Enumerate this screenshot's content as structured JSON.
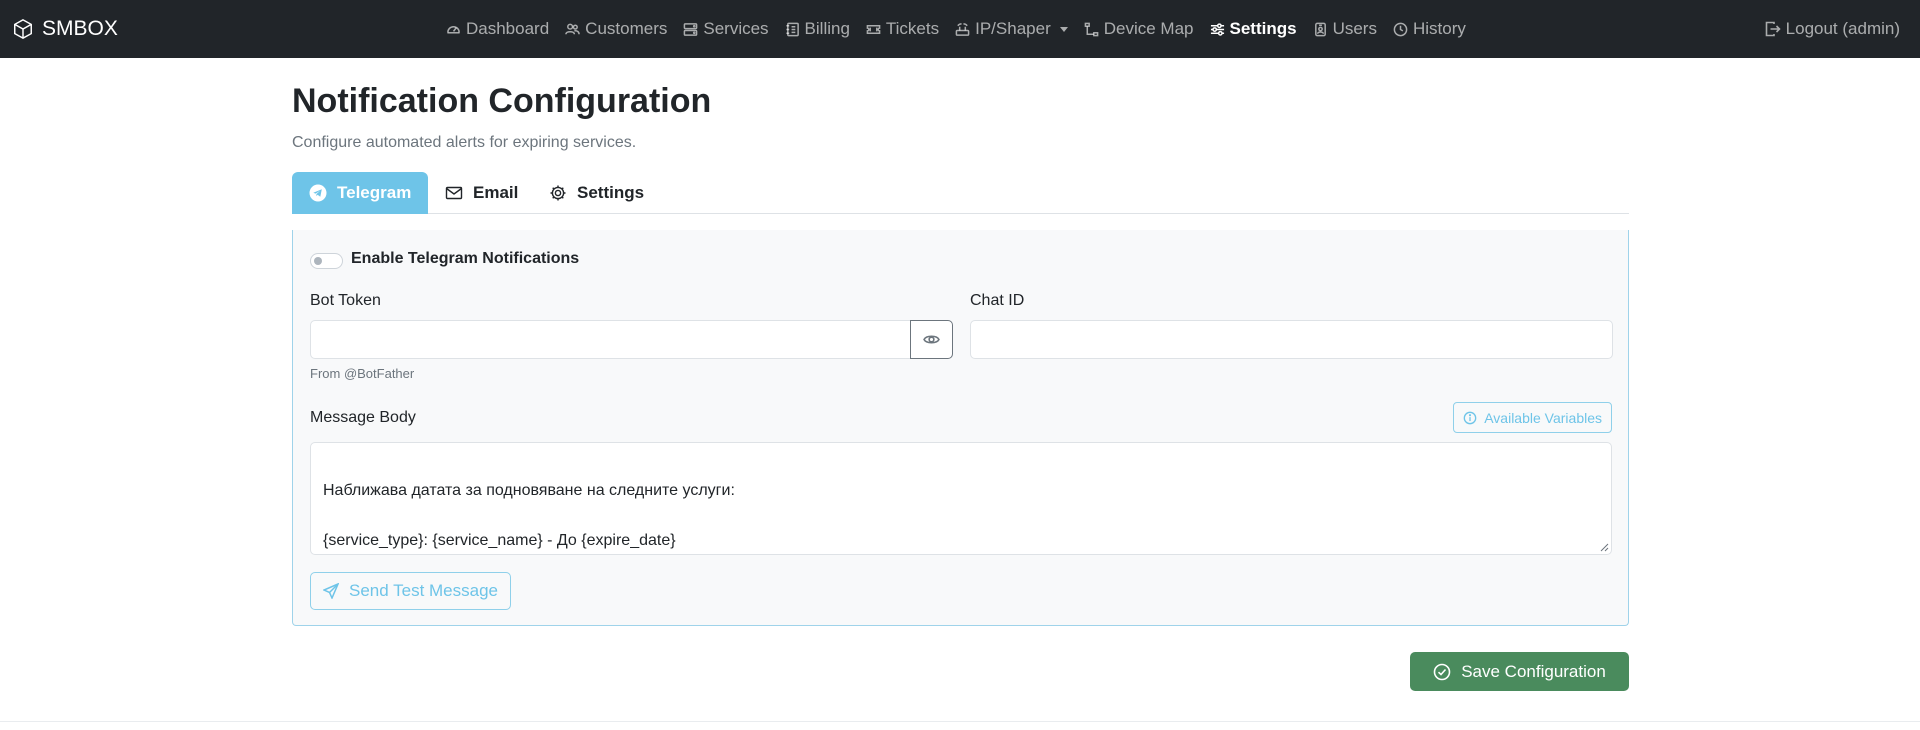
{
  "app": {
    "brand": "SMBOX"
  },
  "nav": {
    "items": [
      {
        "label": "Dashboard",
        "icon": "speedometer-icon",
        "active": false
      },
      {
        "label": "Customers",
        "icon": "people-icon",
        "active": false
      },
      {
        "label": "Services",
        "icon": "hdd-stack-icon",
        "active": false
      },
      {
        "label": "Billing",
        "icon": "journal-icon",
        "active": false
      },
      {
        "label": "Tickets",
        "icon": "ticket-icon",
        "active": false
      },
      {
        "label": "IP/Shaper",
        "icon": "router-icon",
        "active": false,
        "dropdown": true
      },
      {
        "label": "Device Map",
        "icon": "diagram-icon",
        "active": false
      },
      {
        "label": "Settings",
        "icon": "sliders-icon",
        "active": true
      },
      {
        "label": "Users",
        "icon": "person-badge-icon",
        "active": false
      },
      {
        "label": "History",
        "icon": "clock-icon",
        "active": false
      }
    ],
    "logout": "Logout (admin)"
  },
  "page": {
    "title": "Notification Configuration",
    "subtitle": "Configure automated alerts for expiring services."
  },
  "tabs": [
    {
      "label": "Telegram",
      "icon": "telegram-icon",
      "active": true
    },
    {
      "label": "Email",
      "icon": "envelope-icon",
      "active": false
    },
    {
      "label": "Settings",
      "icon": "gear-icon",
      "active": false
    }
  ],
  "telegram": {
    "enable_label": "Enable Telegram Notifications",
    "enabled": false,
    "bot_token_label": "Bot Token",
    "bot_token_value": "",
    "bot_token_help": "From @BotFather",
    "chat_id_label": "Chat ID",
    "chat_id_value": "",
    "message_label": "Message Body",
    "variables_button": "Available Variables",
    "message_line1": "Наближава датата за подновяване на следните услуги:",
    "message_line2": "{service_type}: {service_name} - До {expire_date}",
    "test_button": "Send Test Message"
  },
  "actions": {
    "save_button": "Save Configuration"
  },
  "colors": {
    "navbar": "#212529",
    "accent": "#6ec4e8",
    "save": "#4a8b5d"
  }
}
